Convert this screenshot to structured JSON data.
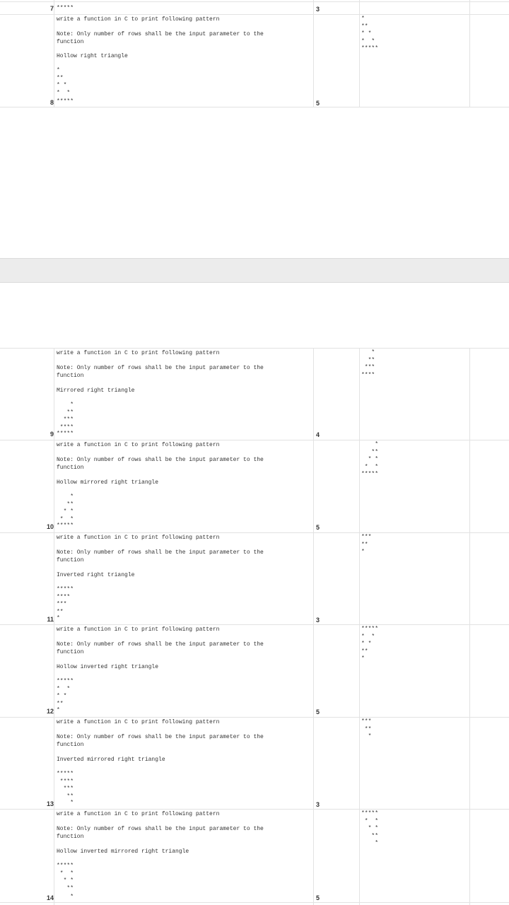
{
  "prompt": "write a function in C to print following pattern",
  "note": "Note: Only number of rows shall be the input parameter to the\nfunction",
  "top": {
    "leading_pattern": "****",
    "row7": {
      "num": "7",
      "pat": "*****",
      "rows": "3"
    },
    "row8": {
      "num": "8",
      "pat": "*****",
      "rows": "5"
    },
    "cell": {
      "title": "Hollow right triangle",
      "pattern": "*\n**\n* *\n*  *",
      "output": "*\n**\n* *\n*  *\n*****"
    }
  },
  "rows": [
    {
      "title": "Mirrored right triangle",
      "pattern": "    *\n   **\n  ***\n ****",
      "rownum": "9",
      "last": "*****",
      "rows": "4",
      "output": "   *\n  **\n ***\n****"
    },
    {
      "title": "Hollow mirrored right triangle",
      "pattern": "    *\n   **\n  * *\n *  *",
      "rownum": "10",
      "last": "*****",
      "rows": "5",
      "output": "    *\n   **\n  * *\n *  *\n*****"
    },
    {
      "title": "Inverted right triangle",
      "pattern": "*****\n****\n***\n**",
      "rownum": "11",
      "last": "*",
      "rows": "3",
      "output": "***\n**\n*"
    },
    {
      "title": "Hollow inverted right triangle",
      "pattern": "*****\n*  *\n* *\n**",
      "rownum": "12",
      "last": "*",
      "rows": "5",
      "output": "*****\n*  *\n* *\n**\n*"
    },
    {
      "title": "Inverted mirrored right triangle",
      "pattern": "*****\n ****\n  ***\n   **",
      "rownum": "13",
      "last": "    *",
      "rows": "3",
      "output": "***\n **\n  *"
    },
    {
      "title": "Hollow inverted mirrored right triangle",
      "pattern": "*****\n *  *\n  * *\n   **",
      "rownum": "14",
      "last": "    *",
      "rows": "5",
      "output": "*****\n *  *\n  * *\n   **\n    *"
    }
  ]
}
